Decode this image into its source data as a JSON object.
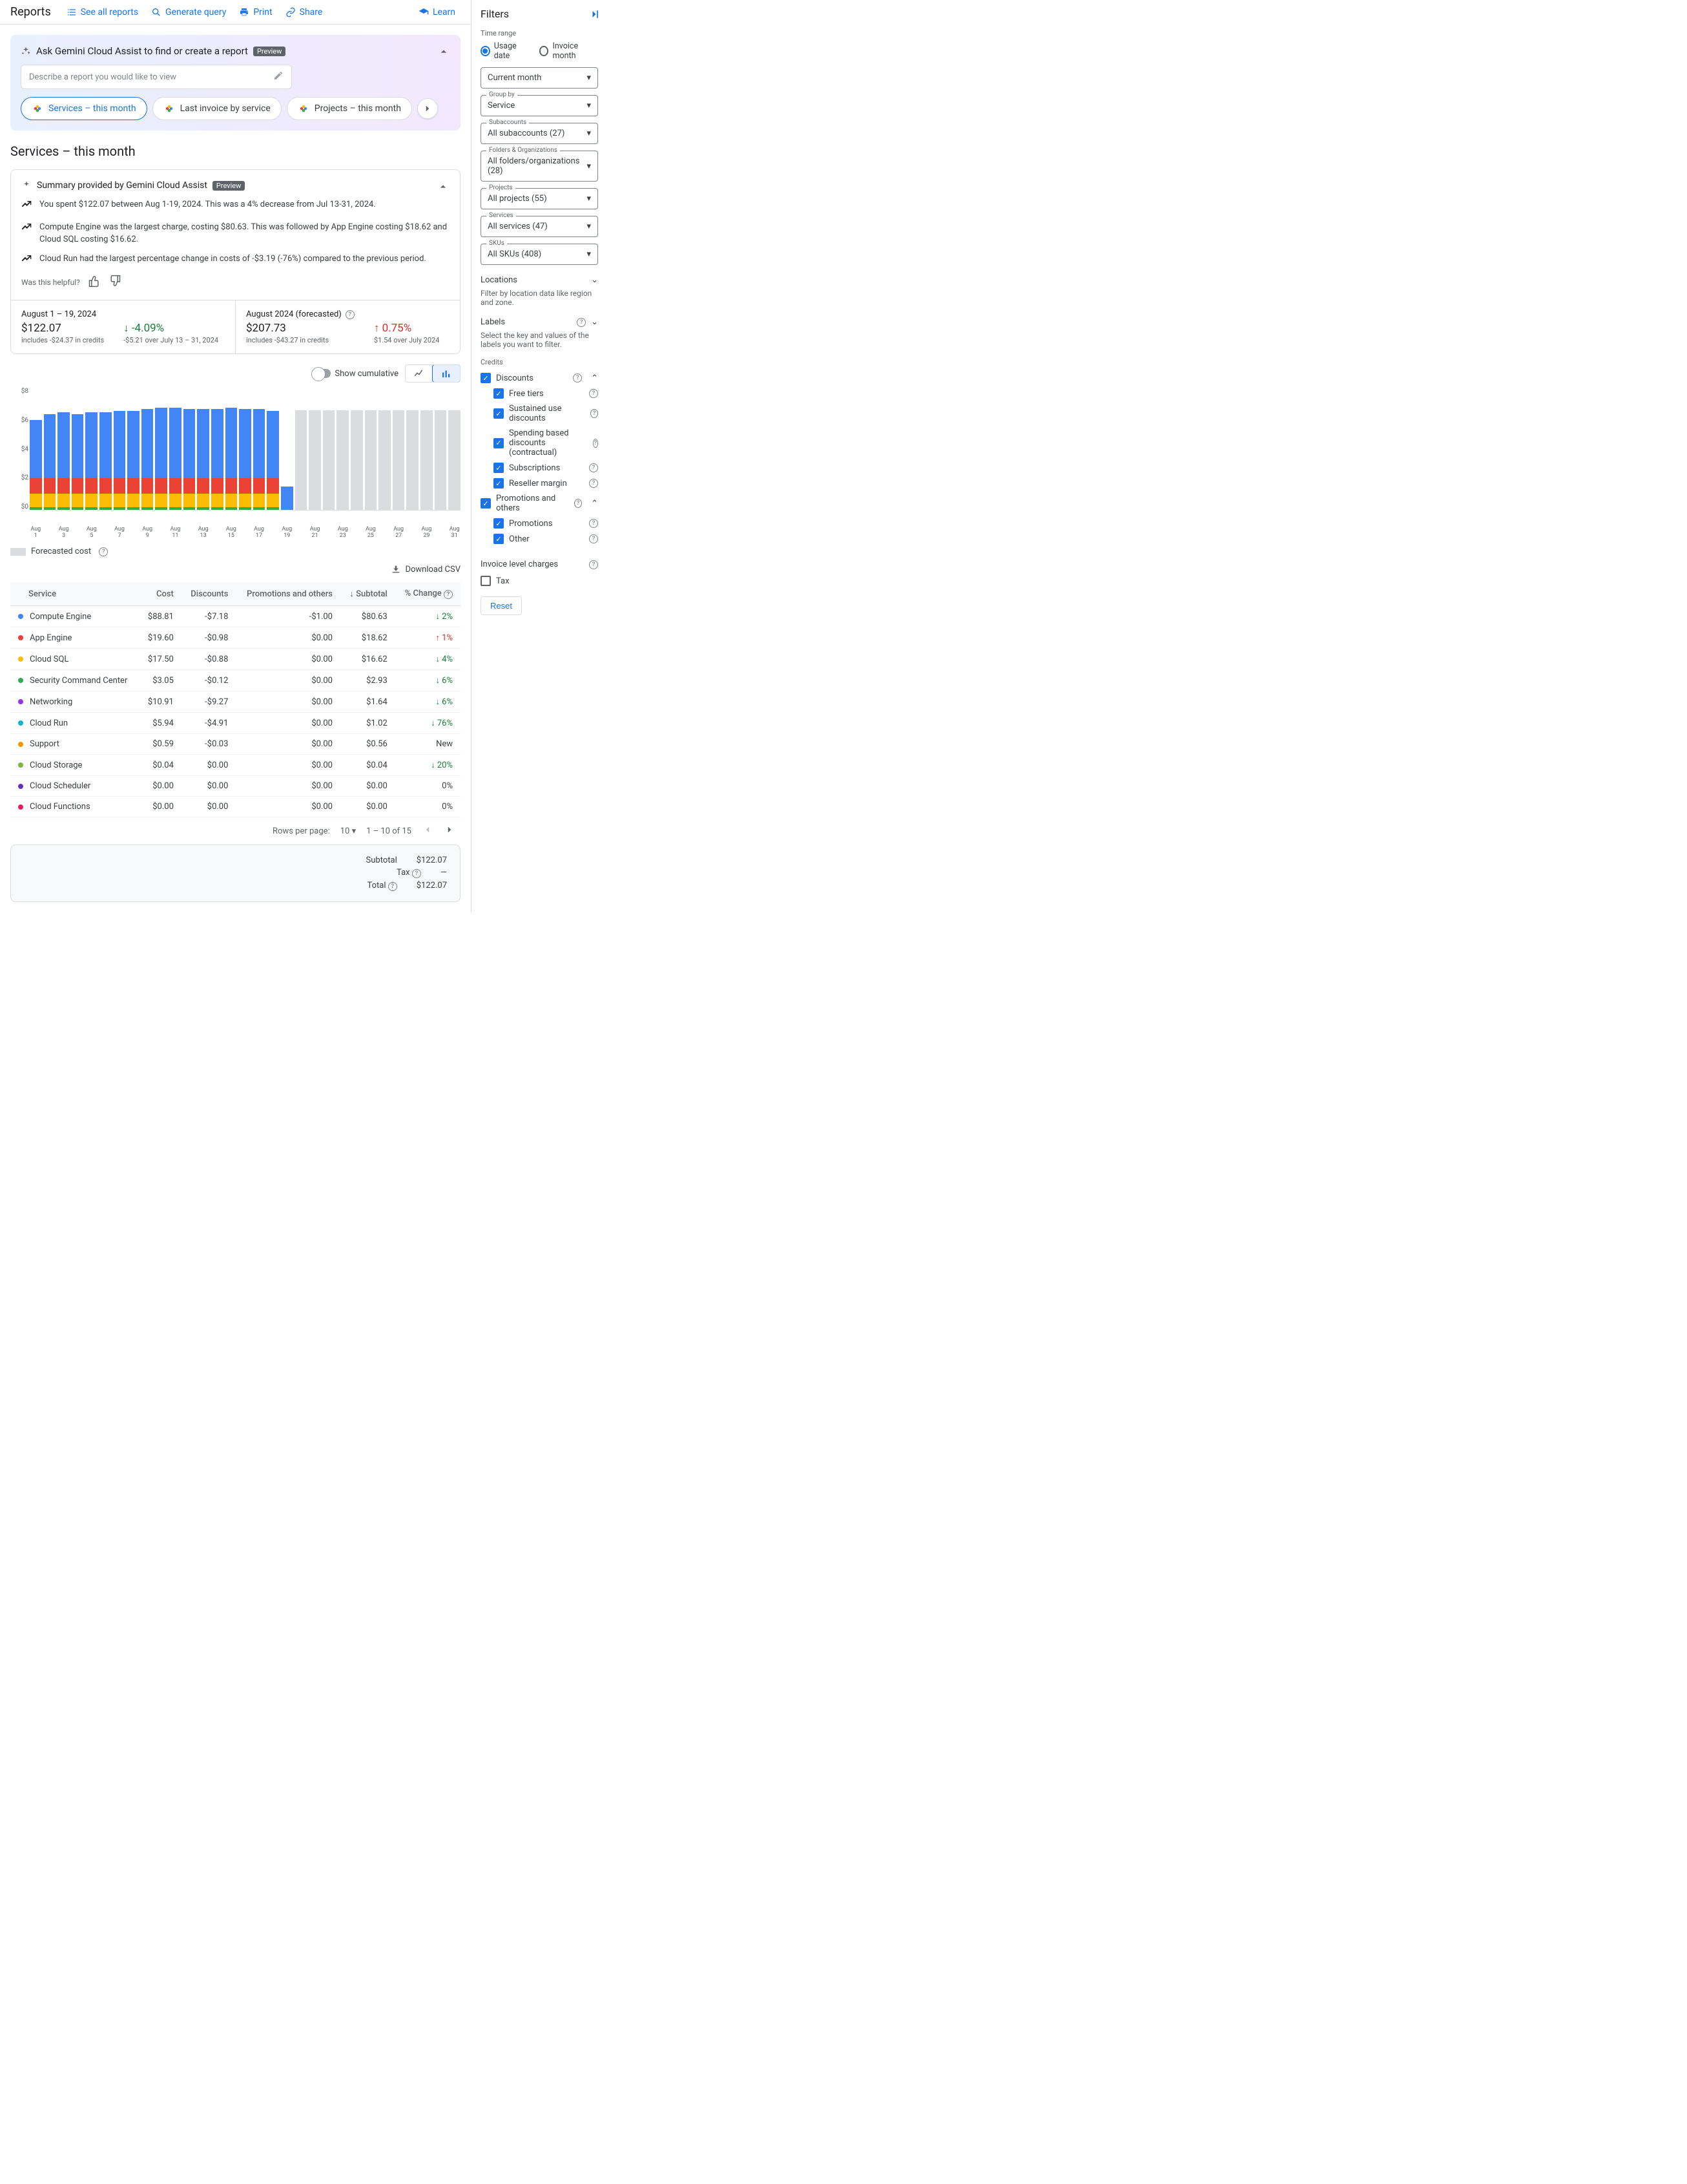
{
  "header": {
    "title": "Reports",
    "see_all": "See all reports",
    "generate": "Generate query",
    "print": "Print",
    "share": "Share",
    "learn": "Learn"
  },
  "gemini": {
    "title": "Ask Gemini Cloud Assist to find or create a report",
    "preview": "Preview",
    "placeholder": "Describe a report you would like to view",
    "chip1": "Services – this month",
    "chip2": "Last invoice by service",
    "chip3": "Projects – this month"
  },
  "page_title": "Services – this month",
  "summary": {
    "title": "Summary provided by Gemini Cloud Assist",
    "preview": "Preview",
    "line1": "You spent $122.07 between Aug 1-19, 2024. This was a 4% decrease from Jul 13-31, 2024.",
    "line2": "Compute Engine was the largest charge, costing $80.63. This was followed by App Engine costing $18.62 and Cloud SQL costing $16.62.",
    "line3": "Cloud Run had the largest percentage change in costs of -$3.19 (-76%) compared to the previous period.",
    "helpful": "Was this helpful?"
  },
  "metrics": {
    "left": {
      "label": "August 1 – 19, 2024",
      "value": "$122.07",
      "sub": "includes -$24.37 in credits",
      "pct": "-4.09%",
      "pct_sub": "-$5.21 over July 13 – 31, 2024"
    },
    "right": {
      "label": "August 2024 (forecasted)",
      "value": "$207.73",
      "sub": "includes -$43.27 in credits",
      "pct": "0.75%",
      "pct_sub": "$1.54 over July 2024"
    }
  },
  "chart_toggle": "Show cumulative",
  "legend_forecast": "Forecasted cost",
  "download": "Download CSV",
  "chart_data": {
    "type": "bar",
    "categories": [
      "Aug 1",
      "",
      "Aug 3",
      "",
      "Aug 5",
      "",
      "Aug 7",
      "",
      "Aug 9",
      "",
      "Aug 11",
      "",
      "Aug 13",
      "",
      "Aug 15",
      "",
      "Aug 17",
      "",
      "Aug 19",
      "",
      "Aug 21",
      "",
      "Aug 23",
      "",
      "Aug 25",
      "",
      "Aug 27",
      "",
      "Aug 29",
      "",
      "Aug 31"
    ],
    "ylim": [
      0,
      8
    ],
    "yticks": [
      "$8",
      "$6",
      "$4",
      "$2",
      "$0"
    ],
    "series": [
      {
        "name": "Compute Engine",
        "color": "#4285f4"
      },
      {
        "name": "App Engine",
        "color": "#ea4335"
      },
      {
        "name": "Cloud SQL",
        "color": "#fbbc04"
      },
      {
        "name": "Other",
        "color": "#34a853"
      },
      {
        "name": "Forecast",
        "color": "#dadce0"
      }
    ],
    "days": [
      {
        "compute": 3.8,
        "app": 1.0,
        "sql": 0.9,
        "other": 0.15,
        "forecast": 0
      },
      {
        "compute": 4.2,
        "app": 1.0,
        "sql": 0.9,
        "other": 0.15,
        "forecast": 0
      },
      {
        "compute": 4.3,
        "app": 1.0,
        "sql": 0.9,
        "other": 0.15,
        "forecast": 0
      },
      {
        "compute": 4.2,
        "app": 1.0,
        "sql": 0.9,
        "other": 0.15,
        "forecast": 0
      },
      {
        "compute": 4.3,
        "app": 1.0,
        "sql": 0.9,
        "other": 0.15,
        "forecast": 0
      },
      {
        "compute": 4.3,
        "app": 1.0,
        "sql": 0.9,
        "other": 0.15,
        "forecast": 0
      },
      {
        "compute": 4.4,
        "app": 1.0,
        "sql": 0.9,
        "other": 0.15,
        "forecast": 0
      },
      {
        "compute": 4.4,
        "app": 1.0,
        "sql": 0.9,
        "other": 0.15,
        "forecast": 0
      },
      {
        "compute": 4.5,
        "app": 1.0,
        "sql": 0.9,
        "other": 0.15,
        "forecast": 0
      },
      {
        "compute": 4.6,
        "app": 1.0,
        "sql": 0.9,
        "other": 0.15,
        "forecast": 0
      },
      {
        "compute": 4.6,
        "app": 1.0,
        "sql": 0.9,
        "other": 0.15,
        "forecast": 0
      },
      {
        "compute": 4.5,
        "app": 1.0,
        "sql": 0.9,
        "other": 0.15,
        "forecast": 0
      },
      {
        "compute": 4.5,
        "app": 1.0,
        "sql": 0.9,
        "other": 0.15,
        "forecast": 0
      },
      {
        "compute": 4.5,
        "app": 1.0,
        "sql": 0.9,
        "other": 0.15,
        "forecast": 0
      },
      {
        "compute": 4.6,
        "app": 1.0,
        "sql": 0.9,
        "other": 0.15,
        "forecast": 0
      },
      {
        "compute": 4.5,
        "app": 1.0,
        "sql": 0.9,
        "other": 0.15,
        "forecast": 0
      },
      {
        "compute": 4.5,
        "app": 1.0,
        "sql": 0.9,
        "other": 0.15,
        "forecast": 0
      },
      {
        "compute": 4.4,
        "app": 1.0,
        "sql": 0.9,
        "other": 0.15,
        "forecast": 0
      },
      {
        "compute": 1.5,
        "app": 0.0,
        "sql": 0.0,
        "other": 0.0,
        "forecast": 0
      },
      {
        "compute": 0,
        "app": 0,
        "sql": 0,
        "other": 0,
        "forecast": 6.5
      },
      {
        "compute": 0,
        "app": 0,
        "sql": 0,
        "other": 0,
        "forecast": 6.5
      },
      {
        "compute": 0,
        "app": 0,
        "sql": 0,
        "other": 0,
        "forecast": 6.5
      },
      {
        "compute": 0,
        "app": 0,
        "sql": 0,
        "other": 0,
        "forecast": 6.5
      },
      {
        "compute": 0,
        "app": 0,
        "sql": 0,
        "other": 0,
        "forecast": 6.5
      },
      {
        "compute": 0,
        "app": 0,
        "sql": 0,
        "other": 0,
        "forecast": 6.5
      },
      {
        "compute": 0,
        "app": 0,
        "sql": 0,
        "other": 0,
        "forecast": 6.5
      },
      {
        "compute": 0,
        "app": 0,
        "sql": 0,
        "other": 0,
        "forecast": 6.5
      },
      {
        "compute": 0,
        "app": 0,
        "sql": 0,
        "other": 0,
        "forecast": 6.5
      },
      {
        "compute": 0,
        "app": 0,
        "sql": 0,
        "other": 0,
        "forecast": 6.5
      },
      {
        "compute": 0,
        "app": 0,
        "sql": 0,
        "other": 0,
        "forecast": 6.5
      },
      {
        "compute": 0,
        "app": 0,
        "sql": 0,
        "other": 0,
        "forecast": 6.5
      }
    ]
  },
  "table": {
    "headers": {
      "service": "Service",
      "cost": "Cost",
      "discounts": "Discounts",
      "promo": "Promotions and others",
      "subtotal": "Subtotal",
      "change": "% Change"
    },
    "rows": [
      {
        "dot": "#4285f4",
        "name": "Compute Engine",
        "cost": "$88.81",
        "disc": "-$7.18",
        "promo": "-$1.00",
        "sub": "$80.63",
        "chg": "2%",
        "dir": "down"
      },
      {
        "dot": "#ea4335",
        "name": "App Engine",
        "cost": "$19.60",
        "disc": "-$0.98",
        "promo": "$0.00",
        "sub": "$18.62",
        "chg": "1%",
        "dir": "up"
      },
      {
        "dot": "#fbbc04",
        "name": "Cloud SQL",
        "cost": "$17.50",
        "disc": "-$0.88",
        "promo": "$0.00",
        "sub": "$16.62",
        "chg": "4%",
        "dir": "down"
      },
      {
        "dot": "#34a853",
        "name": "Security Command Center",
        "cost": "$3.05",
        "disc": "-$0.12",
        "promo": "$0.00",
        "sub": "$2.93",
        "chg": "6%",
        "dir": "down"
      },
      {
        "dot": "#9334e6",
        "name": "Networking",
        "cost": "$10.91",
        "disc": "-$9.27",
        "promo": "$0.00",
        "sub": "$1.64",
        "chg": "6%",
        "dir": "down"
      },
      {
        "dot": "#12b5cb",
        "name": "Cloud Run",
        "cost": "$5.94",
        "disc": "-$4.91",
        "promo": "$0.00",
        "sub": "$1.02",
        "chg": "76%",
        "dir": "down"
      },
      {
        "dot": "#f29900",
        "name": "Support",
        "cost": "$0.59",
        "disc": "-$0.03",
        "promo": "$0.00",
        "sub": "$0.56",
        "chg": "New",
        "dir": "none"
      },
      {
        "dot": "#7cb342",
        "name": "Cloud Storage",
        "cost": "$0.04",
        "disc": "$0.00",
        "promo": "$0.00",
        "sub": "$0.04",
        "chg": "20%",
        "dir": "down"
      },
      {
        "dot": "#5e35b1",
        "name": "Cloud Scheduler",
        "cost": "$0.00",
        "disc": "$0.00",
        "promo": "$0.00",
        "sub": "$0.00",
        "chg": "0%",
        "dir": "none"
      },
      {
        "dot": "#e91e63",
        "name": "Cloud Functions",
        "cost": "$0.00",
        "disc": "$0.00",
        "promo": "$0.00",
        "sub": "$0.00",
        "chg": "0%",
        "dir": "none"
      }
    ],
    "pager": {
      "rpp_label": "Rows per page:",
      "rpp": "10",
      "range": "1 – 10 of 15"
    }
  },
  "totals": {
    "subtotal_l": "Subtotal",
    "subtotal_v": "$122.07",
    "tax_l": "Tax",
    "tax_v": "—",
    "total_l": "Total",
    "total_v": "$122.07"
  },
  "filters": {
    "title": "Filters",
    "time_range": "Time range",
    "usage_date": "Usage date",
    "invoice_month": "Invoice month",
    "current_month": "Current month",
    "group_by_l": "Group by",
    "group_by": "Service",
    "subaccounts_l": "Subaccounts",
    "subaccounts": "All subaccounts (27)",
    "folders_l": "Folders & Organizations",
    "folders": "All folders/organizations (28)",
    "projects_l": "Projects",
    "projects": "All projects (55)",
    "services_l": "Services",
    "services": "All services (47)",
    "skus_l": "SKUs",
    "skus": "All SKUs (408)",
    "locations": "Locations",
    "locations_desc": "Filter by location data like region and zone.",
    "labels": "Labels",
    "labels_desc": "Select the key and values of the labels you want to filter.",
    "credits": "Credits",
    "discounts": "Discounts",
    "free_tiers": "Free tiers",
    "sustained": "Sustained use discounts",
    "spending": "Spending based discounts (contractual)",
    "subscriptions": "Subscriptions",
    "reseller": "Reseller margin",
    "promotions_others": "Promotions and others",
    "promotions": "Promotions",
    "other": "Other",
    "invoice_charges": "Invoice level charges",
    "tax": "Tax",
    "reset": "Reset"
  }
}
